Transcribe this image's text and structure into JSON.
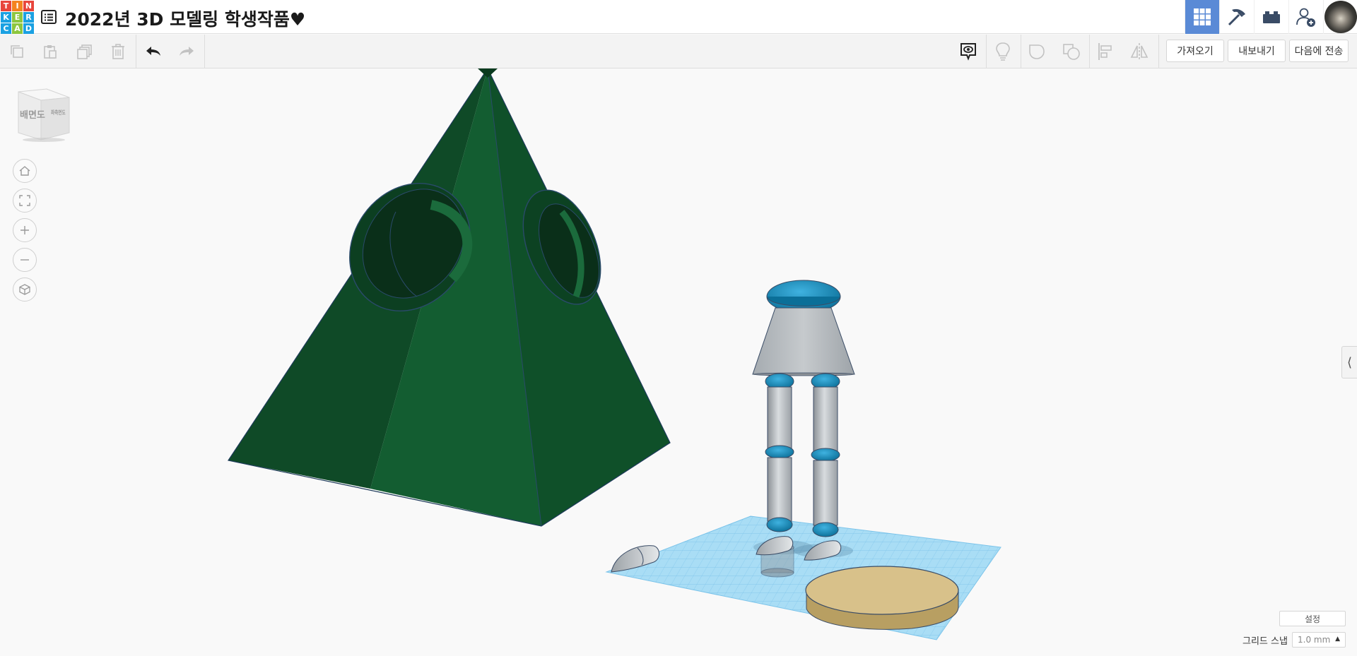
{
  "app": {
    "logo_letters": [
      "T",
      "I",
      "N",
      "K",
      "E",
      "R",
      "C",
      "A",
      "D"
    ],
    "logo_colors": [
      "#e8453c",
      "#f4831f",
      "#e8453c",
      "#1ba1e2",
      "#8dc63f",
      "#1ba1e2",
      "#1ba1e2",
      "#8dc63f",
      "#1ba1e2"
    ],
    "title": "2022년 3D 모델링 학생작품♥"
  },
  "top_nav": {
    "items": [
      {
        "name": "3d-view-grid-icon",
        "active": true
      },
      {
        "name": "pickaxe-icon",
        "active": false
      },
      {
        "name": "bricks-icon",
        "active": false
      },
      {
        "name": "add-user-icon",
        "active": false
      }
    ],
    "accent": "#5a8ad6"
  },
  "toolbar": {
    "import_label": "가져오기",
    "export_label": "내보내기",
    "send_to_label": "다음에 전송"
  },
  "viewcube": {
    "front_label": "배면도",
    "side_label": "좌측면도"
  },
  "footer": {
    "settings_label": "설정",
    "grid_snap_label": "그리드 스냅",
    "grid_snap_value": "1.0 mm"
  },
  "colors": {
    "pyramid": "#135a30",
    "workplane": "#9fd8f5",
    "robot_blue": "#1b8fc0",
    "robot_gray": "#b7bcc0",
    "disc": "#d8c18a"
  }
}
